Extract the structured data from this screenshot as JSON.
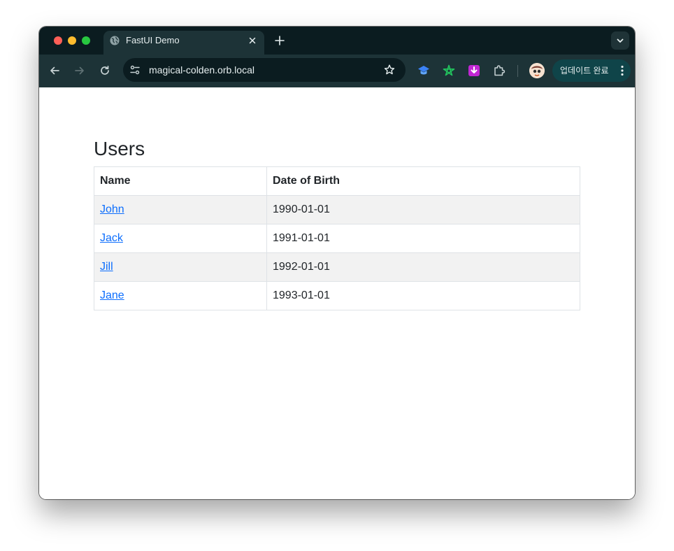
{
  "browser": {
    "tab": {
      "title": "FastUI Demo",
      "icon": "globe-icon"
    },
    "address_bar": {
      "url": "magical-colden.orb.local"
    },
    "update_button": {
      "label": "업데이트 완료"
    },
    "colors": {
      "tabstrip_bg": "#0b1c20",
      "toolbar_bg": "#1d3337",
      "link": "#0d6efd"
    }
  },
  "page": {
    "title": "Users",
    "table": {
      "headers": [
        "Name",
        "Date of Birth"
      ],
      "rows": [
        {
          "name": "John",
          "dob": "1990-01-01"
        },
        {
          "name": "Jack",
          "dob": "1991-01-01"
        },
        {
          "name": "Jill",
          "dob": "1992-01-01"
        },
        {
          "name": "Jane",
          "dob": "1993-01-01"
        }
      ]
    }
  }
}
